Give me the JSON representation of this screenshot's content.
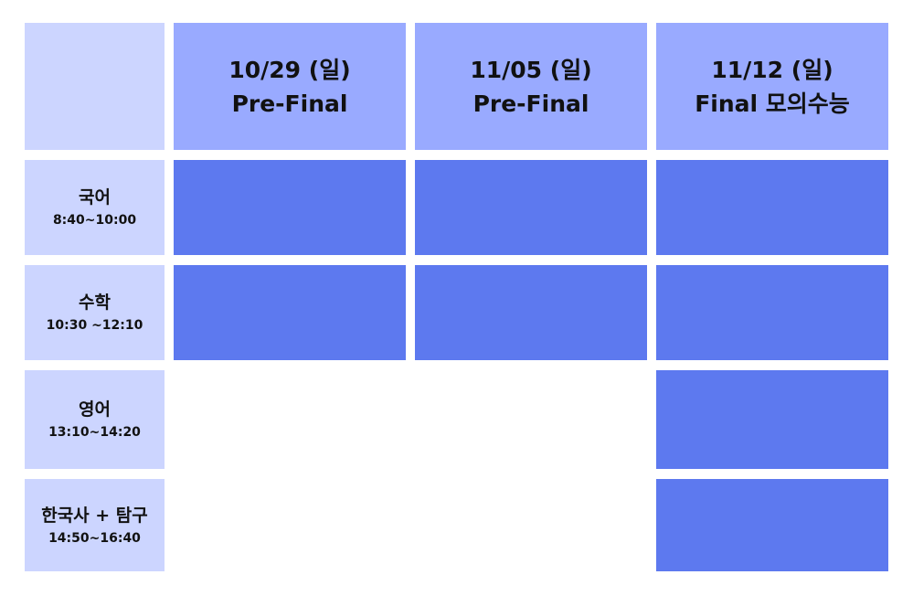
{
  "colors": {
    "corner": "#ccd5ff",
    "column_header": "#99aaff",
    "row_header": "#ccd5ff",
    "scheduled": "#5d79ef",
    "empty": "#ffffff"
  },
  "columns": [
    {
      "date": "10/29 (일)",
      "name": "Pre-Final"
    },
    {
      "date": "11/05 (일)",
      "name": "Pre-Final"
    },
    {
      "date": "11/12 (일)",
      "name": "Final 모의수능"
    }
  ],
  "rows": [
    {
      "subject": "국어",
      "time": "8:40~10:00",
      "scheduled": [
        true,
        true,
        true
      ]
    },
    {
      "subject": "수학",
      "time": "10:30 ~12:10",
      "scheduled": [
        true,
        true,
        true
      ]
    },
    {
      "subject": "영어",
      "time": "13:10~14:20",
      "scheduled": [
        false,
        false,
        true
      ]
    },
    {
      "subject": "한국사 + 탐구",
      "time": "14:50~16:40",
      "scheduled": [
        false,
        false,
        true
      ]
    }
  ]
}
